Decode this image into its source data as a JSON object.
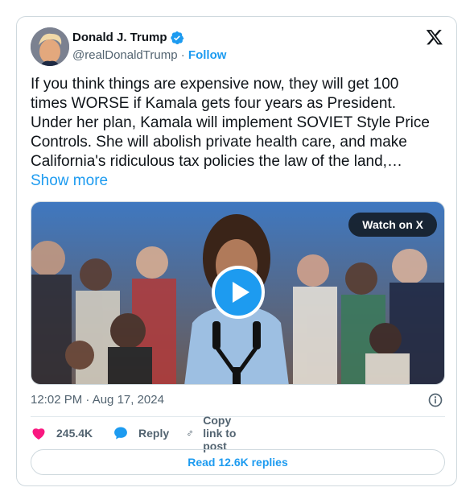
{
  "author": {
    "name": "Donald J. Trump",
    "handle": "@realDonaldTrump",
    "separator": "·",
    "follow_label": "Follow"
  },
  "tweet": {
    "text": "If you think things are expensive now, they will get 100 times WORSE if Kamala gets four years as President. Under her plan, Kamala will implement SOVIET Style Price Controls. She will abolish private health care, and make California's ridiculous tax policies the law of the land,… ",
    "show_more_label": "Show more"
  },
  "media": {
    "watch_label": "Watch on X",
    "play_icon": "play-icon"
  },
  "meta": {
    "timestamp": "12:02 PM · Aug 17, 2024"
  },
  "actions": {
    "likes": "245.4K",
    "reply_label": "Reply",
    "copy_label": "Copy link to post"
  },
  "read_replies_label": "Read 12.6K replies",
  "colors": {
    "accent": "#1d9bf0",
    "like": "#f91880",
    "muted": "#536471"
  }
}
